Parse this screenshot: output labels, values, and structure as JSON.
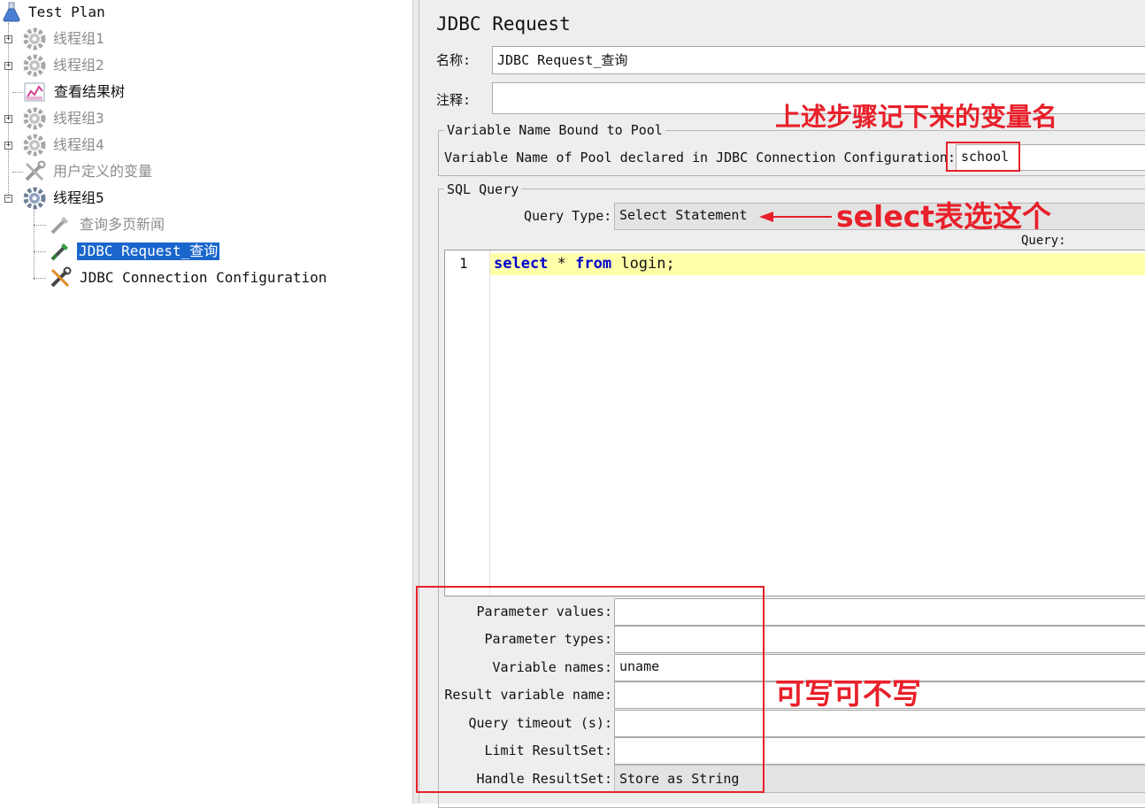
{
  "tree": {
    "root": "Test Plan",
    "items": [
      {
        "label": "线程组1",
        "state": "disabled"
      },
      {
        "label": "线程组2",
        "state": "disabled"
      },
      {
        "label": "查看结果树",
        "state": "normal"
      },
      {
        "label": "线程组3",
        "state": "disabled"
      },
      {
        "label": "线程组4",
        "state": "disabled"
      },
      {
        "label": "用户定义的变量",
        "state": "disabled"
      },
      {
        "label": "线程组5",
        "state": "normal"
      }
    ],
    "children": [
      {
        "label": "查询多页新闻",
        "state": "disabled"
      },
      {
        "label": "JDBC Request_查询",
        "state": "selected"
      },
      {
        "label": "JDBC Connection Configuration",
        "state": "normal"
      }
    ]
  },
  "panel": {
    "title": "JDBC Request",
    "name_label": "名称:",
    "name_value": "JDBC Request_查询",
    "comment_label": "注释:",
    "comment_value": "",
    "pool_group": "Variable Name Bound to Pool",
    "pool_label": "Variable Name of Pool declared in JDBC Connection Configuration:",
    "pool_value": "school",
    "sql_group": "SQL Query",
    "query_type_label": "Query Type:",
    "query_type_value": "Select Statement",
    "query_label": "Query:",
    "editor": {
      "line_number": "1",
      "kw_select": "select",
      "star": " * ",
      "kw_from": "from",
      "rest": " login;"
    },
    "params": [
      {
        "label": "Parameter values:",
        "value": ""
      },
      {
        "label": "Parameter types:",
        "value": ""
      },
      {
        "label": "Variable names:",
        "value": "uname"
      },
      {
        "label": "Result variable name:",
        "value": ""
      },
      {
        "label": "Query timeout (s):",
        "value": ""
      },
      {
        "label": "Limit ResultSet:",
        "value": ""
      },
      {
        "label": "Handle ResultSet:",
        "value": "Store as String"
      }
    ]
  },
  "annotations": {
    "pool_note": "上述步骤记下来的变量名",
    "query_type_note": "select表选这个",
    "params_note": "可写可不写",
    "color": "#e8202a"
  }
}
